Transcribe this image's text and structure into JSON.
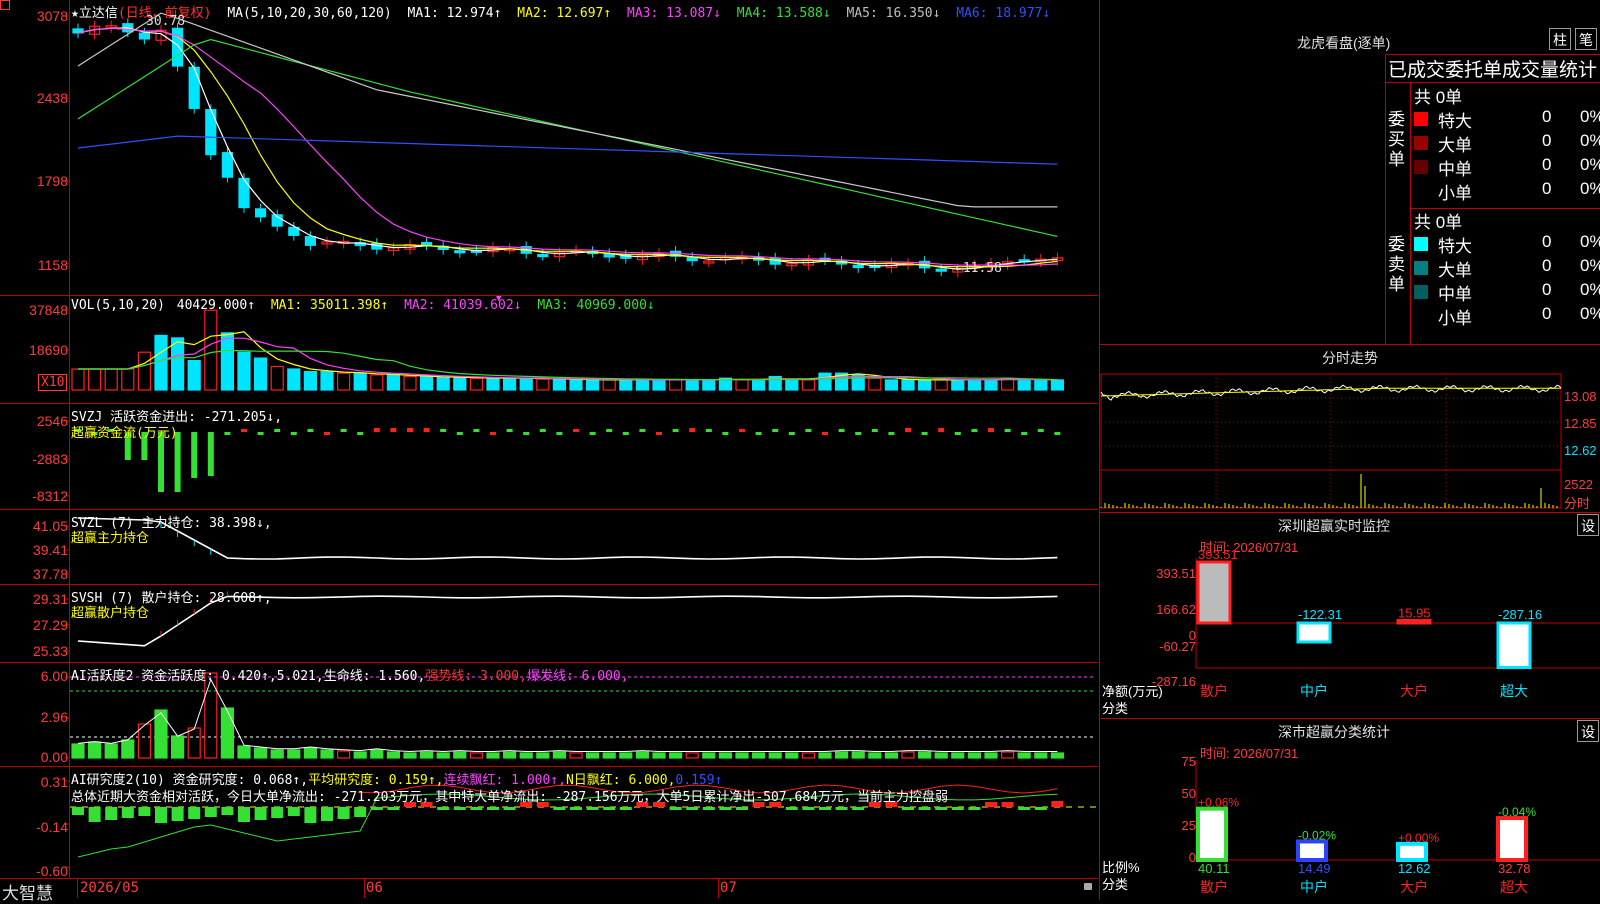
{
  "colors": {
    "bg": "#000000",
    "grid": "#c00000",
    "up": "#ff2020",
    "down": "#00e5ff",
    "green": "#33e033",
    "yellow": "#ffff00",
    "magenta": "#ff40ff",
    "blue": "#3050ff",
    "white": "#ffffff"
  },
  "main": {
    "title": "★立达信",
    "mode": "(日线，前复权)",
    "ma_params": "MA(5,10,20,30,60,120)",
    "ma": [
      {
        "label": "MA1: 12.974↑",
        "color": "#ffffff"
      },
      {
        "label": "MA2: 12.697↑",
        "color": "#ffff00"
      },
      {
        "label": "MA3: 13.087↓",
        "color": "#ff40ff"
      },
      {
        "label": "MA4: 13.588↓",
        "color": "#33e033"
      },
      {
        "label": "MA5: 16.350↓",
        "color": "#c0c0c0"
      },
      {
        "label": "MA6: 18.977↓",
        "color": "#3050ff"
      }
    ],
    "y_ticks": [
      "3078",
      "2438",
      "1798",
      "1158"
    ],
    "high_mark": "30.78",
    "low_mark": "←11.58",
    "pink_marker": "▼"
  },
  "vol": {
    "header": "VOL(5,10,20)",
    "value": "40429.000↑",
    "ma": [
      {
        "label": "MA1: 35011.398↑",
        "color": "#ffff00"
      },
      {
        "label": "MA2: 41039.602↓",
        "color": "#ff40ff"
      },
      {
        "label": "MA3: 40969.000↓",
        "color": "#33e033"
      }
    ],
    "y_ticks": [
      "37848",
      "18690"
    ],
    "unit": "X10",
    "bars": [
      0.25,
      0.25,
      0.25,
      0.25,
      0.45,
      0.65,
      0.62,
      0.35,
      0.95,
      0.68,
      0.45,
      0.38,
      0.28,
      0.25,
      0.22,
      0.22,
      0.2,
      0.2,
      0.18,
      0.18,
      0.16,
      0.16,
      0.15,
      0.15,
      0.14,
      0.14,
      0.14,
      0.14,
      0.13,
      0.13,
      0.12,
      0.12,
      0.12,
      0.12,
      0.12,
      0.12,
      0.12,
      0.12,
      0.12,
      0.14,
      0.12,
      0.12,
      0.16,
      0.12,
      0.12,
      0.2,
      0.2,
      0.18,
      0.14,
      0.12,
      0.12,
      0.12,
      0.12,
      0.12,
      0.12,
      0.12,
      0.14,
      0.12,
      0.12,
      0.12
    ]
  },
  "svzj": {
    "header": "SVZJ  活跃资金进出: -271.205↓,",
    "sub": "超赢资金流(万元)",
    "y_ticks": [
      "2546",
      "-2883",
      "-8312"
    ]
  },
  "svzl": {
    "header": "SVZL (7) 主力持仓: 38.398↓,",
    "sub": "超赢主力持仓",
    "y_ticks": [
      "41.05",
      "39.41",
      "37.78"
    ]
  },
  "svsh": {
    "header": "SVSH (7) 散户持仓: 28.608↑,",
    "sub": "超赢散户持仓",
    "y_ticks": [
      "29.31",
      "27.29",
      "25.33"
    ]
  },
  "aihy": {
    "header_prefix": "AI活跃度2 资金活跃度: 0.420↑,5.021,生命线: 1.560,",
    "strong": "强势线: 3.000,",
    "burst": "爆发线: 6.000,",
    "y_ticks": [
      "6.00",
      "2.96",
      "0.00"
    ]
  },
  "aiyj": {
    "header_prefix": "AI研究度2(10) 资金研究度: 0.068↑,",
    "avg": "平均研究度: 0.159↑,",
    "streak": "连续飘红: 1.000↑,",
    "nday": "N日飘红: 6.000,",
    "tail": "0.159↑",
    "summary": "总体近期大资金相对活跃，今日大单净流出: -271.203万元，其中特大单净流出: -287.156万元，大单5日累计净出-507.684万元，当前主力控盘弱",
    "y_ticks": [
      "0.31",
      "-0.14",
      "-0.60"
    ]
  },
  "xaxis": {
    "labels": [
      "2026/05",
      "06",
      "07"
    ],
    "brand": "大智慧"
  },
  "dragon": {
    "title": "龙虎看盘(逐单)",
    "btn1": "柱",
    "btn2": "笔",
    "subtitle": "已成交委托单成交量统计",
    "buy_label": "委买单",
    "sell_label": "委卖单",
    "buy": {
      "total": "共 0单",
      "rows": [
        {
          "name": "特大",
          "v": "0",
          "p": "0%",
          "c": "#ff0000"
        },
        {
          "name": "大单",
          "v": "0",
          "p": "0%",
          "c": "#990000"
        },
        {
          "name": "中单",
          "v": "0",
          "p": "0%",
          "c": "#660000"
        },
        {
          "name": "小单",
          "v": "0",
          "p": "0%",
          "c": "#000000"
        }
      ]
    },
    "sell": {
      "total": "共 0单",
      "rows": [
        {
          "name": "特大",
          "v": "0",
          "p": "0%",
          "c": "#00ffff"
        },
        {
          "name": "大单",
          "v": "0",
          "p": "0%",
          "c": "#008080"
        },
        {
          "name": "中单",
          "v": "0",
          "p": "0%",
          "c": "#006060"
        },
        {
          "name": "小单",
          "v": "0",
          "p": "0%",
          "c": "#000000"
        }
      ]
    }
  },
  "intraday": {
    "title": "分时走势",
    "prices": [
      "13.08",
      "12.85",
      "12.62"
    ],
    "vol_label": "2522",
    "unit": "分时"
  },
  "monitor": {
    "title": "深圳超赢实时监控",
    "btn": "设",
    "time": "时间: 2026/07/31",
    "y_ticks": [
      "393.51",
      "166.62",
      "0",
      "-60.27",
      "-287.16"
    ],
    "ylabel": "净额(万元)",
    "xlabel": "分类",
    "bars": [
      {
        "cat": "散户",
        "value": 393.51,
        "label": "393.51",
        "type": "up"
      },
      {
        "cat": "中户",
        "value": -122.31,
        "label": "-122.31",
        "type": "down"
      },
      {
        "cat": "大户",
        "value": 15.95,
        "label": "15.95",
        "type": "up"
      },
      {
        "cat": "超大",
        "value": -287.16,
        "label": "-287.16",
        "type": "down"
      }
    ]
  },
  "stat": {
    "title": "深市超赢分类统计",
    "btn": "设",
    "time": "时间: 2026/07/31",
    "y_ticks": [
      "75",
      "50",
      "25",
      "0"
    ],
    "ylabel": "比例%",
    "xlabel": "分类",
    "bars": [
      {
        "cat": "散户",
        "value": 40.11,
        "label": "40.11",
        "chg": "+0.06%",
        "style": "green"
      },
      {
        "cat": "中户",
        "value": 14.49,
        "label": "14.49",
        "chg": "-0.02%",
        "style": "blue"
      },
      {
        "cat": "大户",
        "value": 12.62,
        "label": "12.62",
        "chg": "+0.00%",
        "style": "cyan"
      },
      {
        "cat": "超大",
        "value": 32.78,
        "label": "32.78",
        "chg": "-0.04%",
        "style": "red"
      }
    ]
  }
}
